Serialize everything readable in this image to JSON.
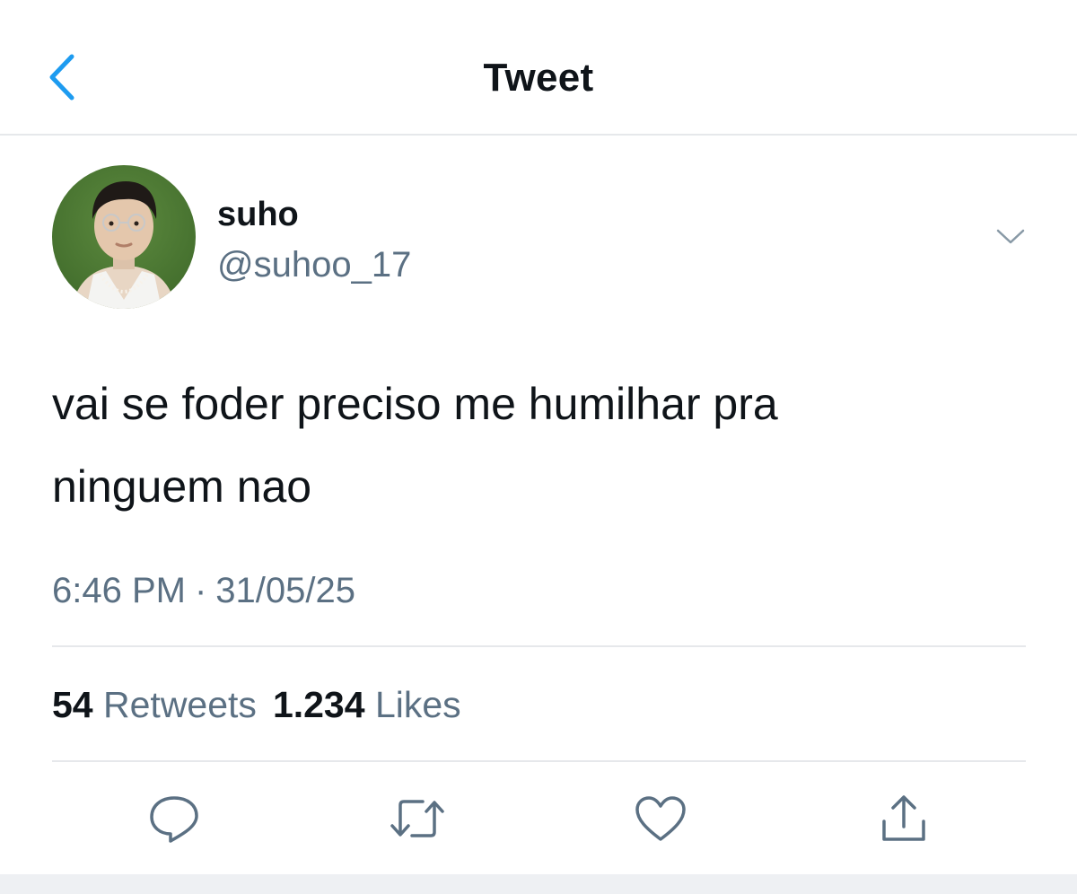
{
  "nav": {
    "title": "Tweet",
    "back_icon": "chevron-left-icon",
    "accent_color": "#1d9bf0"
  },
  "author": {
    "display_name": "suho",
    "username": "@suhoo_17"
  },
  "tweet": {
    "text_line1": "vai se foder preciso me humilhar pra",
    "text_line2": "ninguem nao",
    "time": "6:46 PM",
    "separator": "·",
    "date": "31/05/25"
  },
  "stats": {
    "retweets_count": "54",
    "retweets_label": "Retweets",
    "likes_count": "1.234",
    "likes_label": "Likes"
  },
  "actions": [
    {
      "icon": "reply-icon"
    },
    {
      "icon": "retweet-icon"
    },
    {
      "icon": "like-icon"
    },
    {
      "icon": "share-icon"
    }
  ],
  "colors": {
    "text_primary": "#0f1419",
    "text_secondary": "#5b7083",
    "divider": "#e6e8eb",
    "icon": "#5b7083"
  }
}
